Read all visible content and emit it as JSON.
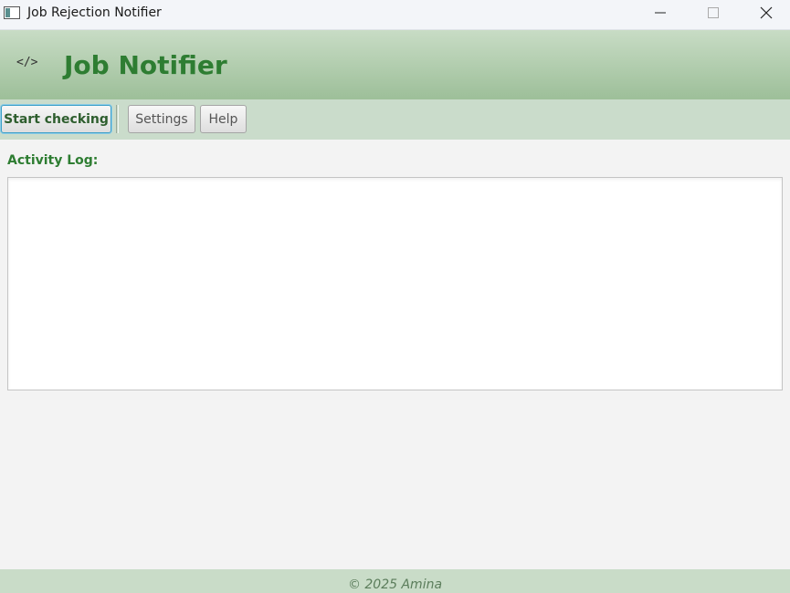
{
  "window": {
    "title": "Job Rejection Notifier",
    "icons": [
      "app-window-icon",
      "minimize-icon",
      "maximize-icon",
      "close-icon"
    ]
  },
  "header": {
    "logo_icon_text": "</>",
    "title": "Job Notifier"
  },
  "toolbar": {
    "start_label": "Start checking",
    "settings_label": "Settings",
    "help_label": "Help"
  },
  "main": {
    "log_label": "Activity Log:",
    "log_content": ""
  },
  "footer": {
    "text": "© 2025 Amina"
  },
  "colors": {
    "accent_green": "#2e7d32",
    "header_gradient_top": "#c8dcc5",
    "header_gradient_bottom": "#9dbf99",
    "toolbar_bg": "#cadccb",
    "focus_blue": "#3ba0c8"
  }
}
